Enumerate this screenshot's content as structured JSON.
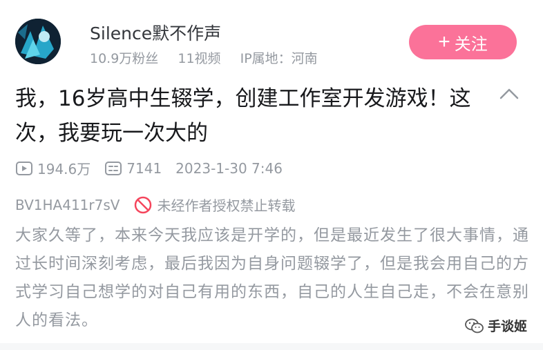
{
  "author": {
    "name": "Silence默不作声",
    "followers": "10.9万粉丝",
    "videos": "11视频",
    "ip": "IP属地：河南"
  },
  "follow_button": {
    "label": "关注",
    "icon": "plus-icon"
  },
  "video": {
    "title": "我，16岁高中生辍学，创建工作室开发游戏！这次，我要玩一次大的",
    "views": "194.6万",
    "danmaku": "7141",
    "date": "2023-1-30 7:46",
    "bvid": "BV1HA411r7sV",
    "copyright": "未经作者授权禁止转载",
    "description": "大家久等了，本来今天我应该是开学的，但是最近发生了很大事情，通过长时间深刻考虑，最后我因为自身问题辍学了，但是我会用自己的方式学习自己想学的对自己有用的东西，自己的人生自己走，不会在意别人的看法。"
  },
  "watermark": {
    "text": "手谈姬",
    "icon": "wechat-icon"
  },
  "colors": {
    "accent": "#fb7299",
    "muted": "#9499a0",
    "text": "#18191c",
    "ban": "#f5455c"
  }
}
